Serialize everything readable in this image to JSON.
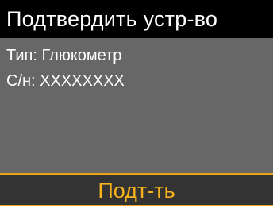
{
  "header": {
    "title": "Подтвердить устр-во"
  },
  "device": {
    "type_line": "Тип: Глюкометр",
    "serial_line": "С/н: XXXXXXXX"
  },
  "footer": {
    "confirm_label": "Подт-ть"
  },
  "colors": {
    "header_bg": "#000000",
    "panel_bg": "#676767",
    "footer_bg": "#333333",
    "accent": "#e8a317",
    "text": "#ffffff"
  }
}
